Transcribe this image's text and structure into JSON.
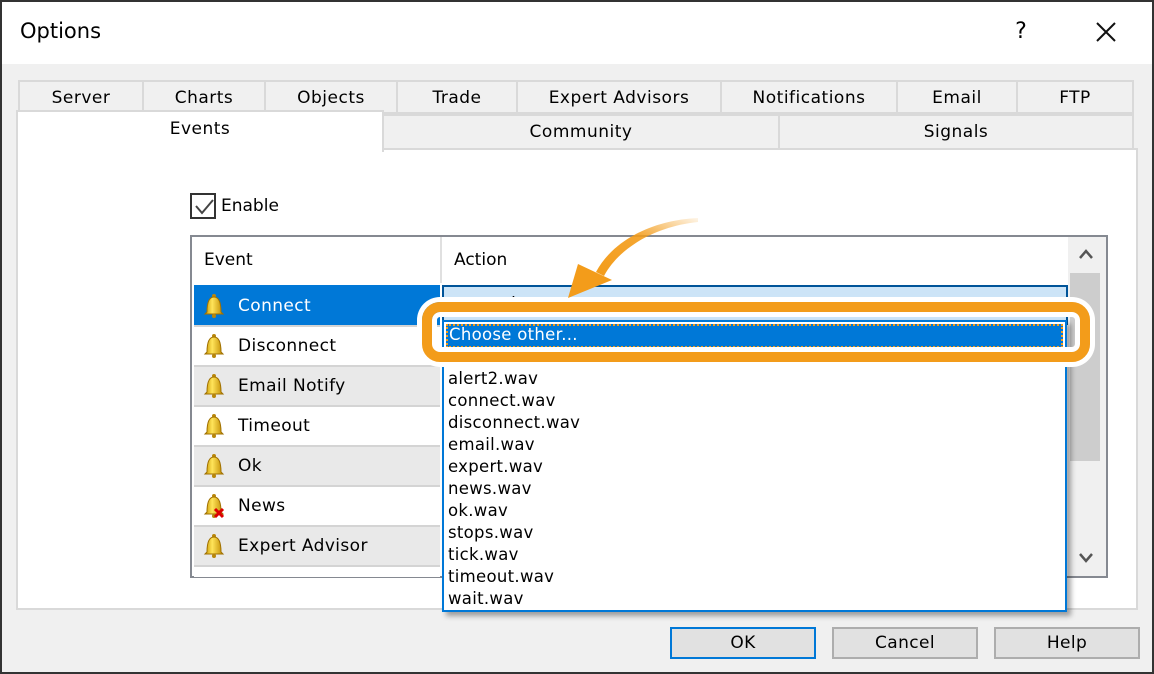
{
  "window": {
    "title": "Options",
    "help_label": "?",
    "close_icon": "close-icon"
  },
  "tabs": {
    "row1": [
      {
        "label": "Server"
      },
      {
        "label": "Charts"
      },
      {
        "label": "Objects"
      },
      {
        "label": "Trade"
      },
      {
        "label": "Expert Advisors"
      },
      {
        "label": "Notifications"
      },
      {
        "label": "Email"
      },
      {
        "label": "FTP"
      }
    ],
    "row2": [
      {
        "label": "Events",
        "active": true
      },
      {
        "label": "Community"
      },
      {
        "label": "Signals"
      }
    ]
  },
  "events_panel": {
    "enable_label": "Enable",
    "enable_checked": true,
    "columns": {
      "event": "Event",
      "action": "Action"
    },
    "rows": [
      {
        "event": "Connect",
        "icon": "bell-icon",
        "selected": true
      },
      {
        "event": "Disconnect",
        "icon": "bell-icon"
      },
      {
        "event": "Email Notify",
        "icon": "bell-icon"
      },
      {
        "event": "Timeout",
        "icon": "bell-icon"
      },
      {
        "event": "Ok",
        "icon": "bell-icon"
      },
      {
        "event": "News",
        "icon": "bell-disabled-icon"
      },
      {
        "event": "Expert Advisor",
        "icon": "bell-icon"
      }
    ],
    "action_value": "connect.wav",
    "dropdown": {
      "highlighted": "Choose other...",
      "options": [
        "alert2.wav",
        "connect.wav",
        "disconnect.wav",
        "email.wav",
        "expert.wav",
        "news.wav",
        "ok.wav",
        "stops.wav",
        "tick.wav",
        "timeout.wav",
        "wait.wav"
      ]
    }
  },
  "buttons": {
    "ok": "OK",
    "cancel": "Cancel",
    "help": "Help"
  },
  "colors": {
    "accent": "#0078d7",
    "callout": "#f39c1a",
    "selected_field": "#cce4f7"
  }
}
